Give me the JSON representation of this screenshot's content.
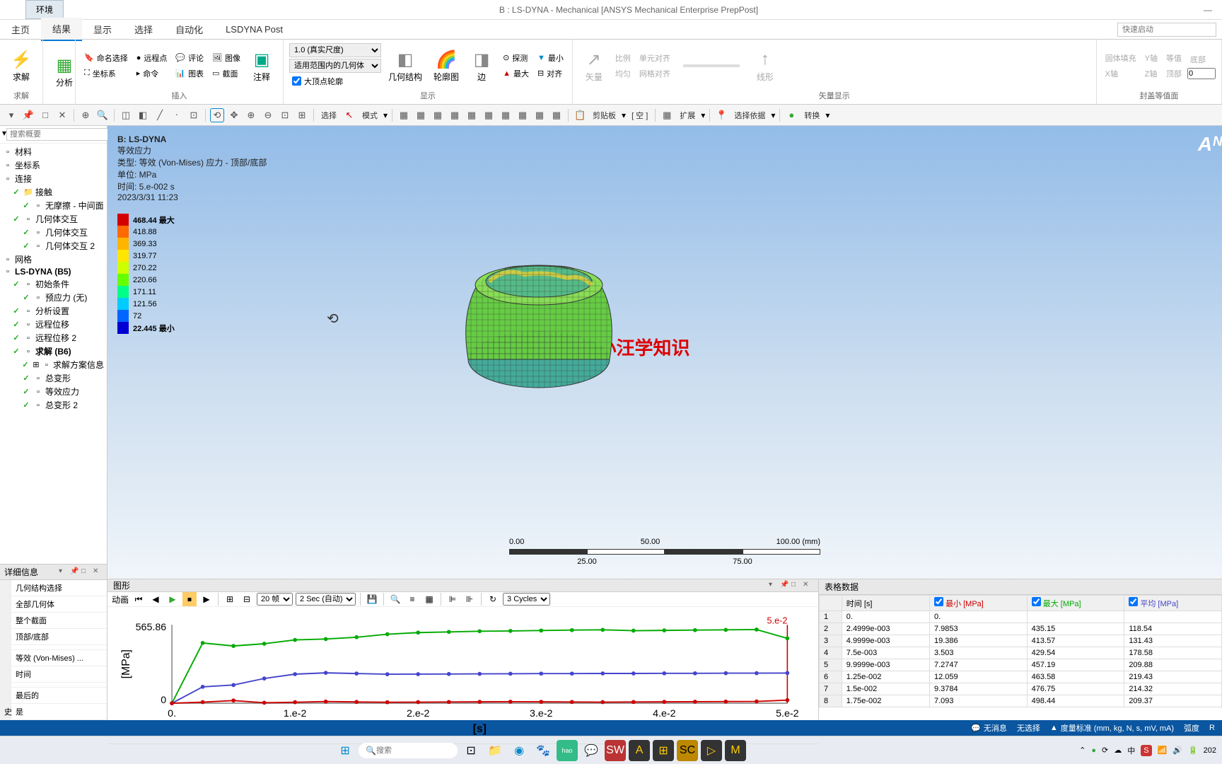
{
  "titlebar": {
    "tab": "环境",
    "title": "B : LS-DYNA - Mechanical [ANSYS Mechanical Enterprise PrepPost]"
  },
  "menubar": {
    "items": [
      "主页",
      "结果",
      "显示",
      "选择",
      "自动化",
      "LSDYNA Post"
    ],
    "active": 1,
    "quick_launch_placeholder": "快速启动"
  },
  "ribbon": {
    "solve": {
      "label": "求解",
      "group": "求解"
    },
    "analysis": {
      "label": "分析"
    },
    "insert_group": "插入",
    "insert_items": {
      "named_sel": "命名选择",
      "remote": "远程点",
      "comment": "评论",
      "image": "图像",
      "coord": "坐标系",
      "cmd": "命令",
      "chart": "图表",
      "section": "截面",
      "annot": "注释"
    },
    "scale_sel": "1.0 (真实尺度)",
    "scope_sel": "适用范围内的几何体",
    "large_vertex": "大顶点轮廓",
    "display_group": "显示",
    "geom": "几何结构",
    "contour": "轮廓图",
    "edge": "边",
    "probe": "探测",
    "max": "最大",
    "min": "最小",
    "align": "对齐",
    "vector_group": "矢量显示",
    "vector": "矢量",
    "proportion": "比例",
    "uniform": "均匀",
    "unit_align": "单元对齐",
    "grid_align": "网格对齐",
    "linear": "线形",
    "solid_fill": "固体填充",
    "y_axis": "Y轴",
    "x_axis": "X轴",
    "z_axis": "Z轴",
    "contour_level": "等值",
    "bottom": "底部",
    "top": "顶部",
    "cap_group": "封盖等值面",
    "cap_val": "0"
  },
  "toolbar": {
    "select": "选择",
    "mode": "模式",
    "clipboard": "剪贴板",
    "empty": "[ 空 ]",
    "expand": "扩展",
    "select_by": "选择依据",
    "convert": "转换"
  },
  "tree": {
    "search_placeholder": "搜索概要",
    "items": [
      {
        "label": "材料",
        "indent": 0
      },
      {
        "label": "坐标系",
        "indent": 0
      },
      {
        "label": "连接",
        "indent": 0
      },
      {
        "label": "接触",
        "indent": 1,
        "icon": "folder",
        "check": true
      },
      {
        "label": "无摩擦 - 中间面",
        "indent": 2,
        "check": true
      },
      {
        "label": "几何体交互",
        "indent": 1,
        "check": true
      },
      {
        "label": "几何体交互",
        "indent": 2,
        "check": true
      },
      {
        "label": "几何体交互 2",
        "indent": 2,
        "check": true
      },
      {
        "label": "网格",
        "indent": 0
      },
      {
        "label": "LS-DYNA (B5)",
        "indent": 0,
        "bold": true
      },
      {
        "label": "初始条件",
        "indent": 1,
        "check": true
      },
      {
        "label": "预应力 (无)",
        "indent": 2,
        "check": true
      },
      {
        "label": "分析设置",
        "indent": 1,
        "check": true
      },
      {
        "label": "远程位移",
        "indent": 1,
        "check": true
      },
      {
        "label": "远程位移 2",
        "indent": 1,
        "check": true
      },
      {
        "label": "求解 (B6)",
        "indent": 1,
        "check": true,
        "bold": true
      },
      {
        "label": "求解方案信息",
        "indent": 2,
        "check": true,
        "expand": true
      },
      {
        "label": "总变形",
        "indent": 2,
        "check": true
      },
      {
        "label": "等效应力",
        "indent": 2,
        "check": true
      },
      {
        "label": "总变形 2",
        "indent": 2,
        "check": true
      }
    ]
  },
  "details": {
    "title": "详细信息",
    "rows": [
      {
        "k": "",
        "v": "几何结构选择"
      },
      {
        "k": "",
        "v": "全部几何体"
      },
      {
        "k": "",
        "v": "整个截面"
      },
      {
        "k": "",
        "v": "顶部/底部"
      },
      {
        "k": "",
        "v": ""
      },
      {
        "k": "",
        "v": "等效 (Von-Mises) ..."
      },
      {
        "k": "",
        "v": "时间"
      },
      {
        "k": "",
        "v": ""
      },
      {
        "k": "",
        "v": "最后的"
      },
      {
        "k": "史",
        "v": "是"
      }
    ]
  },
  "viewport": {
    "title": "B: LS-DYNA",
    "subtitle": "等效应力",
    "type_line": "类型: 等效 (Von-Mises) 应力 - 顶部/底部",
    "unit_line": "单位: MPa",
    "time_line": "时间: 5.e-002 s",
    "date_line": "2023/3/31 11:23",
    "legend": [
      {
        "color": "#d40000",
        "label": "468.44 最大",
        "bold": true
      },
      {
        "color": "#ff6a00",
        "label": "418.88"
      },
      {
        "color": "#ffb400",
        "label": "369.33"
      },
      {
        "color": "#ffe600",
        "label": "319.77"
      },
      {
        "color": "#ccff00",
        "label": "270.22"
      },
      {
        "color": "#66ff00",
        "label": "220.66"
      },
      {
        "color": "#00ff88",
        "label": "171.11"
      },
      {
        "color": "#00ccff",
        "label": "121.56"
      },
      {
        "color": "#0066ff",
        "label": "72"
      },
      {
        "color": "#0000d4",
        "label": "22.445 最小",
        "bold": true
      }
    ],
    "watermark": "小汪学知识",
    "logo": "Aᴺ",
    "scale": {
      "min": "0.00",
      "q1": "25.00",
      "mid": "50.00",
      "q3": "75.00",
      "max": "100.00 (mm)"
    }
  },
  "graph": {
    "title": "图形",
    "anim_label": "动画",
    "frames_sel": "20 帧",
    "time_sel": "2 Sec (自动)",
    "cycles_sel": "3 Cycles",
    "y_label": "[MPa]",
    "x_label": "[s]",
    "y_max": "565.86",
    "y_min": "0",
    "x_ticks": [
      "0.",
      "1.e-2",
      "2.e-2",
      "3.e-2",
      "4.e-2",
      "5.e-2"
    ],
    "marker": "5.e-2"
  },
  "table": {
    "title": "表格数据",
    "headers": {
      "time": "时间 [s]",
      "min": "最小 [MPa]",
      "max": "最大 [MPa]",
      "avg": "平均 [MPa]"
    },
    "rows": [
      {
        "n": "1",
        "t": "0.",
        "min": "0.",
        "max": "",
        "avg": ""
      },
      {
        "n": "2",
        "t": "2.4999e-003",
        "min": "7.9853",
        "max": "435.15",
        "avg": "118.54"
      },
      {
        "n": "3",
        "t": "4.9999e-003",
        "min": "19.386",
        "max": "413.57",
        "avg": "131.43"
      },
      {
        "n": "4",
        "t": "7.5e-003",
        "min": "3.503",
        "max": "429.54",
        "avg": "178.58"
      },
      {
        "n": "5",
        "t": "9.9999e-003",
        "min": "7.2747",
        "max": "457.19",
        "avg": "209.88"
      },
      {
        "n": "6",
        "t": "1.25e-002",
        "min": "12.059",
        "max": "463.58",
        "avg": "219.43"
      },
      {
        "n": "7",
        "t": "1.5e-002",
        "min": "9.3784",
        "max": "476.75",
        "avg": "214.32"
      },
      {
        "n": "8",
        "t": "1.75e-002",
        "min": "7.093",
        "max": "498.44",
        "avg": "209.37"
      }
    ]
  },
  "statusbar": {
    "no_msg": "无消息",
    "no_sel": "无选择",
    "metric": "度量标准 (mm, kg, N, s, mV, mA)",
    "deg": "弧度",
    "r": "R"
  },
  "taskbar": {
    "search_placeholder": "搜索",
    "time": "202"
  },
  "chart_data": {
    "type": "line",
    "title": "等效应力",
    "xlabel": "[s]",
    "ylabel": "[MPa]",
    "xlim": [
      0,
      0.05
    ],
    "ylim": [
      0,
      565.86
    ],
    "x": [
      0,
      0.0025,
      0.005,
      0.0075,
      0.01,
      0.0125,
      0.015,
      0.0175,
      0.02,
      0.0225,
      0.025,
      0.0275,
      0.03,
      0.0325,
      0.035,
      0.0375,
      0.04,
      0.0425,
      0.045,
      0.0475,
      0.05
    ],
    "series": [
      {
        "name": "最大",
        "color": "#0a0",
        "values": [
          0,
          435.15,
          413.57,
          429.54,
          457.19,
          463.58,
          476.75,
          498.44,
          510,
          515,
          520,
          522,
          525,
          528,
          530,
          524,
          526,
          528,
          530,
          532,
          468.44
        ]
      },
      {
        "name": "平均",
        "color": "#44c",
        "values": [
          0,
          118.54,
          131.43,
          178.58,
          209.88,
          219.43,
          214.32,
          209.37,
          210,
          211,
          212,
          213,
          214,
          214,
          215,
          215,
          216,
          216,
          217,
          217,
          218
        ]
      },
      {
        "name": "最小",
        "color": "#c00",
        "values": [
          0,
          7.99,
          19.39,
          3.5,
          7.27,
          12.06,
          9.38,
          7.09,
          8,
          9,
          10,
          11,
          10,
          9,
          8,
          9,
          10,
          11,
          12,
          13,
          22.45
        ]
      }
    ]
  }
}
